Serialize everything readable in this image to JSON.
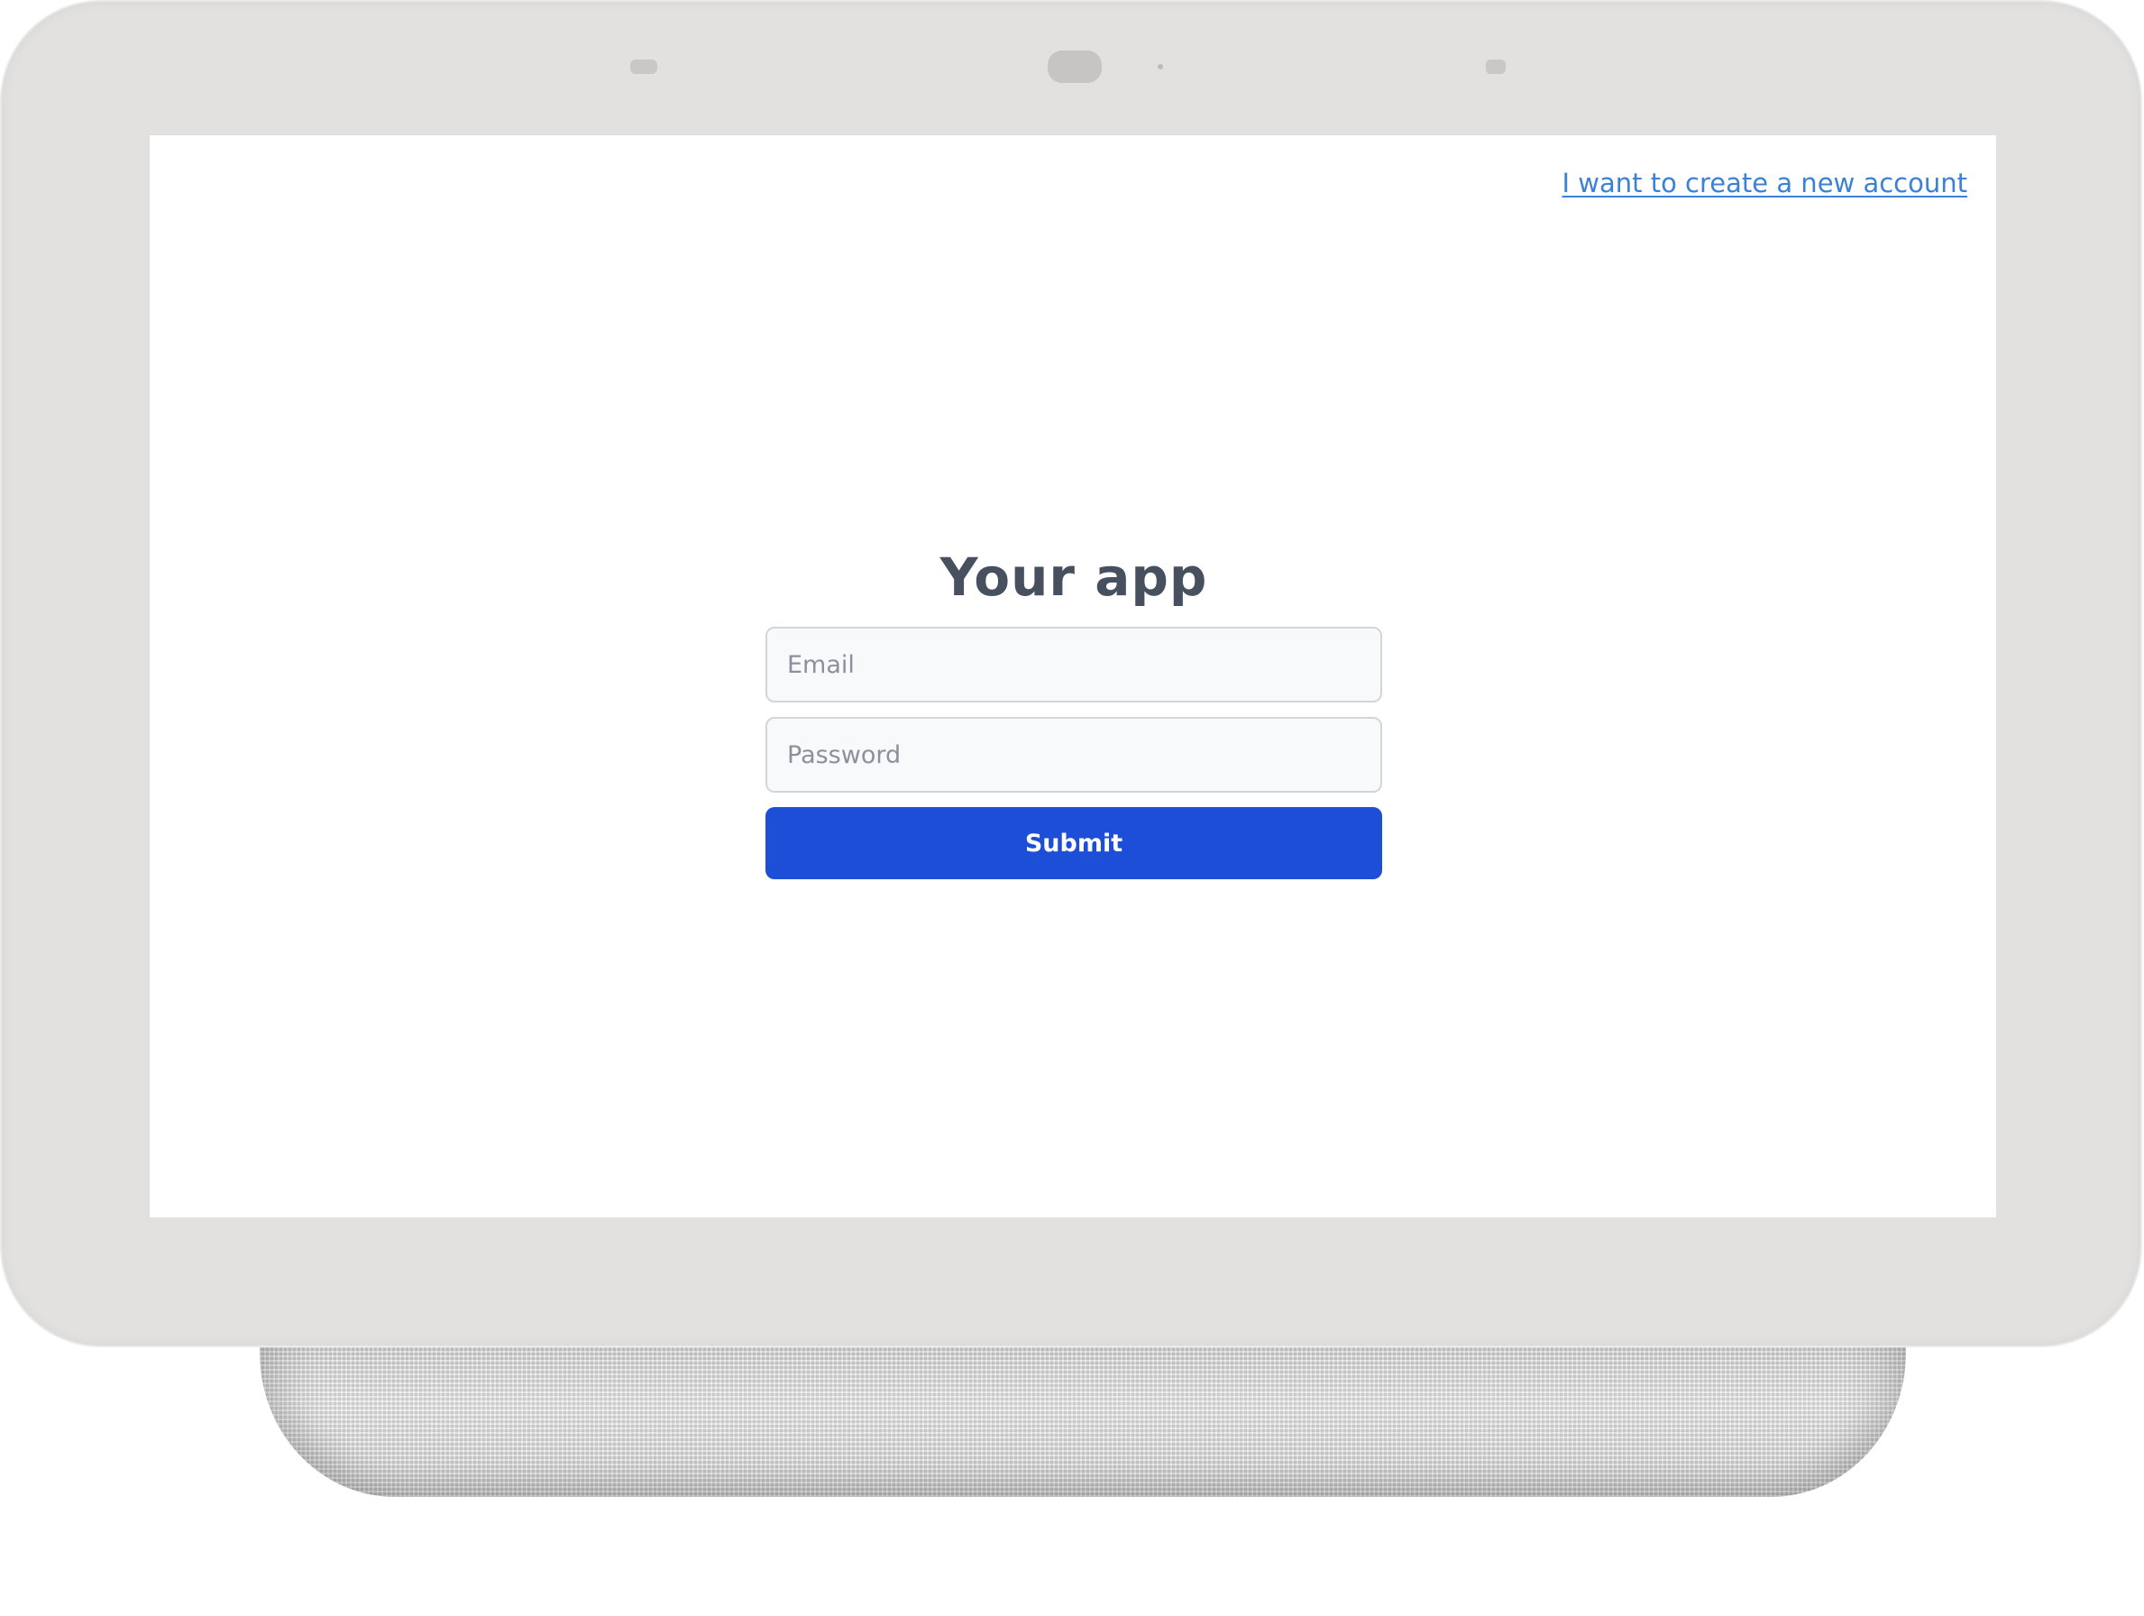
{
  "header": {
    "create_account_link": "I want to create a new account"
  },
  "login": {
    "title": "Your app",
    "email_placeholder": "Email",
    "email_value": "",
    "password_placeholder": "Password",
    "password_value": "",
    "submit_label": "Submit"
  },
  "colors": {
    "accent": "#1d4ed8",
    "link": "#3b82d6",
    "title_text": "#47505e",
    "device_frame": "#e2e1e0"
  }
}
